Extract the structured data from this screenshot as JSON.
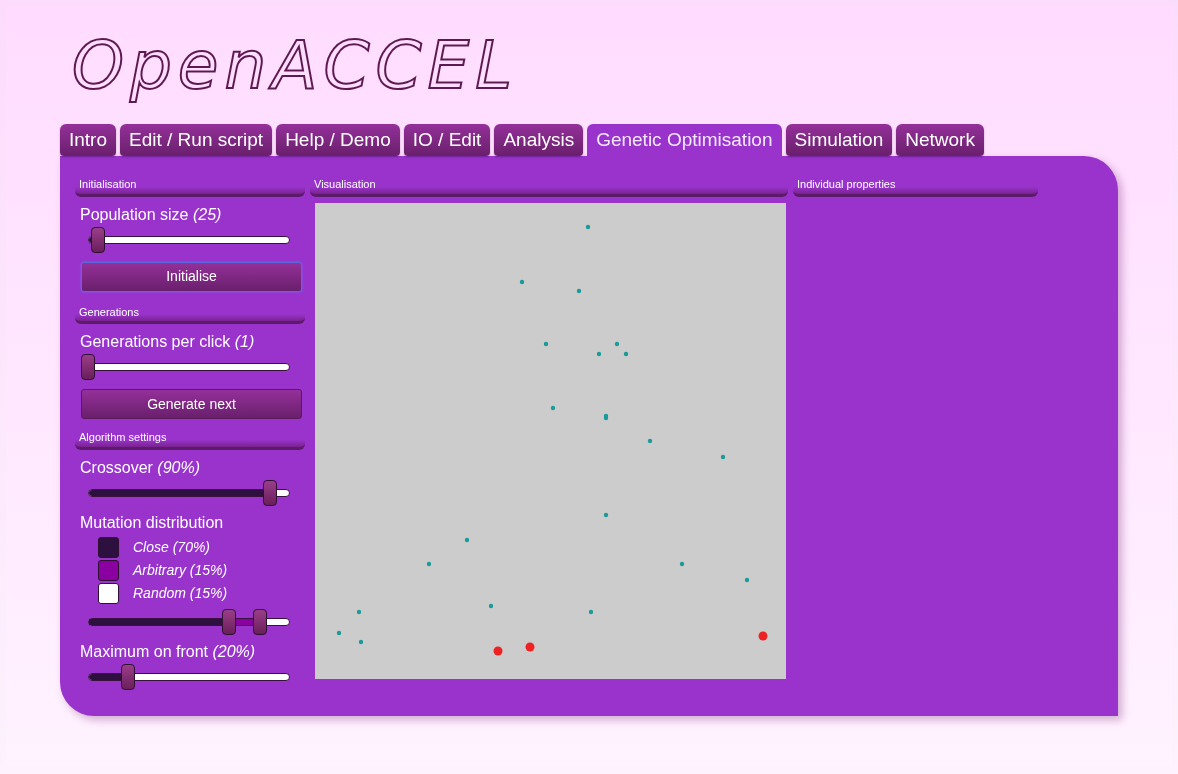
{
  "logo": "OpenACCEL",
  "tabs": [
    {
      "label": "Intro",
      "selected": false
    },
    {
      "label": "Edit / Run script",
      "selected": false
    },
    {
      "label": "Help / Demo",
      "selected": false
    },
    {
      "label": "IO / Edit",
      "selected": false
    },
    {
      "label": "Analysis",
      "selected": false
    },
    {
      "label": "Genetic Optimisation",
      "selected": true
    },
    {
      "label": "Simulation",
      "selected": false
    },
    {
      "label": "Network",
      "selected": false
    }
  ],
  "initialisation": {
    "heading": "Initialisation",
    "slider": {
      "label": "Population size",
      "value": "(25)",
      "level": 0.05
    },
    "button": {
      "label": "Initialise",
      "focused": true
    }
  },
  "generations": {
    "heading": "Generations",
    "slider": {
      "label": "Generations per click",
      "value": "(1)",
      "level": 0
    },
    "button": {
      "label": "Generate next",
      "focused": false
    }
  },
  "algorithm_settings": {
    "heading": "Algorithm settings",
    "crossover": {
      "label": "Crossover",
      "value": "(90%)",
      "level": 0.9
    },
    "mutation_distribution": {
      "label": "Mutation distribution",
      "items": [
        {
          "label": "Close",
          "value": "(70%)",
          "color": "#2e1040"
        },
        {
          "label": "Arbitrary",
          "value": "(15%)",
          "color": "#8a00a0"
        },
        {
          "label": "Random",
          "value": "(15%)",
          "color": "#ffffff"
        }
      ],
      "handles": [
        {
          "level": 0.7
        },
        {
          "level": 0.85
        }
      ]
    },
    "maximum_on_front": {
      "label": "Maximum on front",
      "value": "(20%)",
      "level": 0.2
    }
  },
  "visualisation": {
    "heading": "Visualisation"
  },
  "individual_properties": {
    "heading": "Individual properties"
  }
}
